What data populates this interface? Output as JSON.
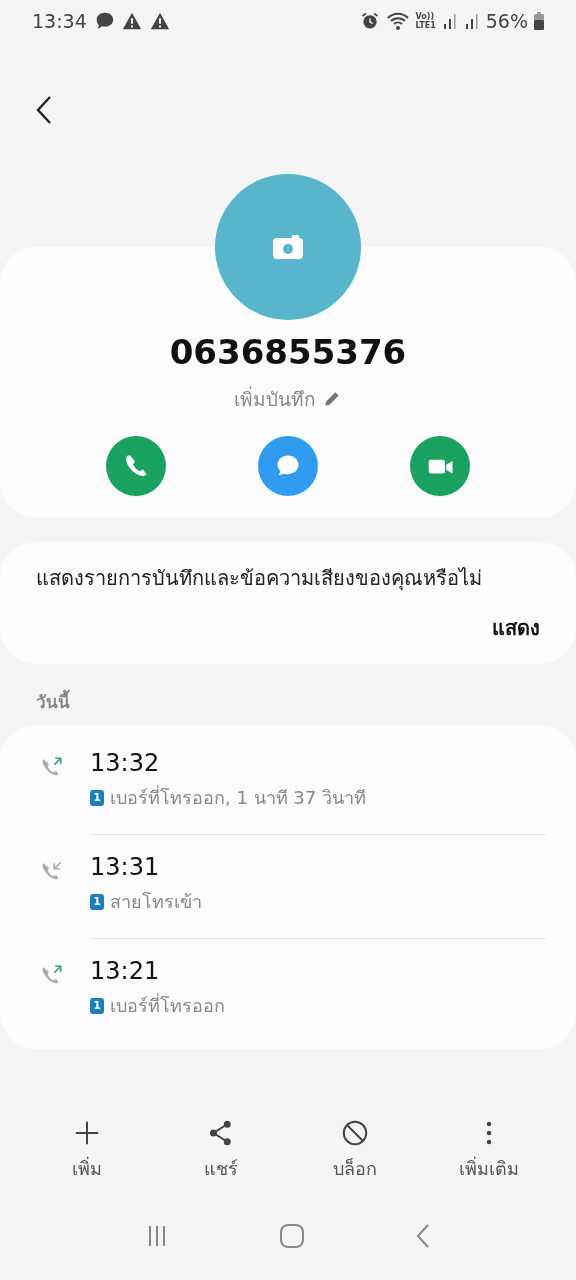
{
  "status_bar": {
    "time": "13:34",
    "volte": [
      "Vo))",
      "LTE1"
    ],
    "battery": "56%"
  },
  "contact": {
    "number": "0636855376",
    "note_label": "เพิ่มบันทึก"
  },
  "actions": [
    {
      "kind": "call"
    },
    {
      "kind": "message"
    },
    {
      "kind": "video"
    }
  ],
  "prompt": {
    "text": "แสดงรายการบันทึกและข้อความเสียงของคุณหรือไม่",
    "button": "แสดง"
  },
  "section_header": "วันนี้",
  "calls": [
    {
      "kind": "outgoing",
      "time": "13:32",
      "sim": "1",
      "detail": "เบอร์ที่โทรออก, 1 นาที 37 วินาที"
    },
    {
      "kind": "incoming",
      "time": "13:31",
      "sim": "1",
      "detail": "สายโทรเข้า"
    },
    {
      "kind": "outgoing",
      "time": "13:21",
      "sim": "1",
      "detail": "เบอร์ที่โทรออก"
    }
  ],
  "bottom_actions": [
    {
      "kind": "add",
      "label": "เพิ่ม"
    },
    {
      "kind": "share",
      "label": "แชร์"
    },
    {
      "kind": "block",
      "label": "บล็อก"
    },
    {
      "kind": "more",
      "label": "เพิ่มเติม"
    }
  ]
}
